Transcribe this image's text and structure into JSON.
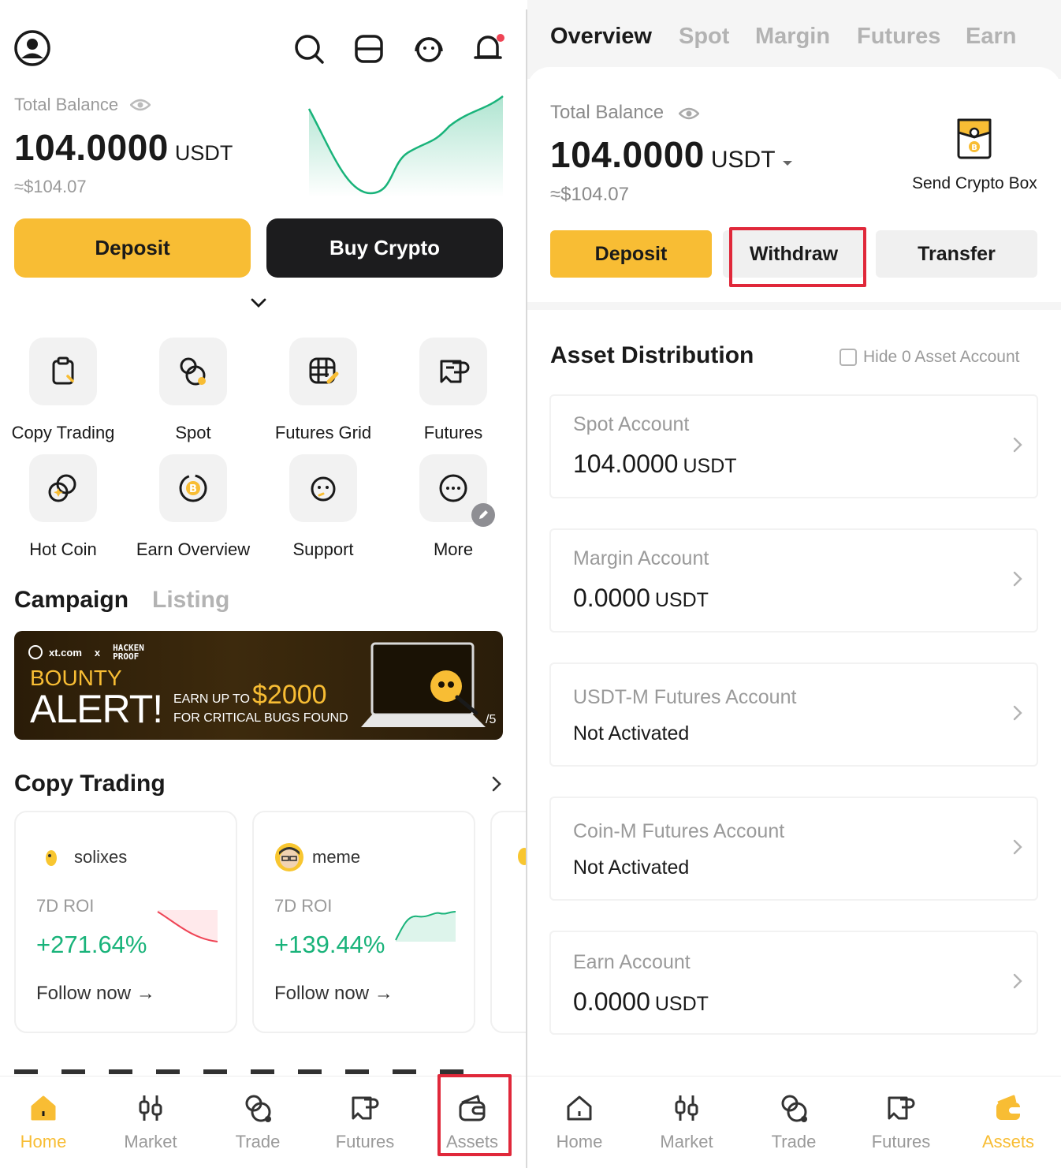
{
  "left": {
    "total_balance_label": "Total Balance",
    "balance": "104.0000",
    "unit": "USDT",
    "fiat": "≈$104.07",
    "deposit": "Deposit",
    "buy_crypto": "Buy Crypto",
    "shortcuts": [
      {
        "label": "Copy Trading",
        "icon": "clipboard-icon"
      },
      {
        "label": "Spot",
        "icon": "spot-icon"
      },
      {
        "label": "Futures Grid",
        "icon": "grid-icon"
      },
      {
        "label": "Futures",
        "icon": "futures-icon"
      },
      {
        "label": "Hot Coin",
        "icon": "hot-coin-icon"
      },
      {
        "label": "Earn Overview",
        "icon": "coin-icon"
      },
      {
        "label": "Support",
        "icon": "support-icon"
      },
      {
        "label": "More",
        "icon": "more-icon"
      }
    ],
    "campaign_tab": "Campaign",
    "listing_tab": "Listing",
    "banner": {
      "brand": "xt.com",
      "times": "x",
      "partner": "HACKEN PROOF",
      "line1": "BOUNTY",
      "line2": "ALERT!",
      "earn_up_to": "EARN UP TO",
      "amount": "$2000",
      "critical": "FOR CRITICAL BUGS FOUND",
      "page": "/5"
    },
    "copy_trading_title": "Copy Trading",
    "traders": [
      {
        "name": "solixes",
        "roi_label": "7D ROI",
        "roi": "+271.64%",
        "follow": "Follow now →"
      },
      {
        "name": "meme",
        "roi_label": "7D ROI",
        "roi": "+139.44%",
        "follow": "Follow now →"
      }
    ],
    "tabs": [
      {
        "label": "Home",
        "icon": "home-icon",
        "active": true
      },
      {
        "label": "Market",
        "icon": "candlestick-icon",
        "active": false
      },
      {
        "label": "Trade",
        "icon": "trade-icon",
        "active": false
      },
      {
        "label": "Futures",
        "icon": "futures-icon",
        "active": false
      },
      {
        "label": "Assets",
        "icon": "wallet-icon",
        "active": false
      }
    ]
  },
  "right": {
    "top_tabs": [
      "Overview",
      "Spot",
      "Margin",
      "Futures",
      "Earn"
    ],
    "total_balance_label": "Total Balance",
    "balance": "104.0000",
    "unit": "USDT",
    "fiat": "≈$104.07",
    "send_crypto_box": "Send Crypto Box",
    "deposit": "Deposit",
    "withdraw": "Withdraw",
    "transfer": "Transfer",
    "asset_distribution": "Asset Distribution",
    "hide_zero": "Hide 0 Asset Account",
    "accounts": [
      {
        "name": "Spot Account",
        "value": "104.0000",
        "unit": "USDT"
      },
      {
        "name": "Margin Account",
        "value": "0.0000",
        "unit": "USDT"
      },
      {
        "name": "USDT-M Futures Account",
        "value": "Not Activated",
        "unit": ""
      },
      {
        "name": "Coin-M Futures Account",
        "value": "Not Activated",
        "unit": ""
      },
      {
        "name": "Earn Account",
        "value": "0.0000",
        "unit": "USDT"
      }
    ],
    "tabs": [
      {
        "label": "Home",
        "icon": "home-icon",
        "active": false
      },
      {
        "label": "Market",
        "icon": "candlestick-icon",
        "active": false
      },
      {
        "label": "Trade",
        "icon": "trade-icon",
        "active": false
      },
      {
        "label": "Futures",
        "icon": "futures-icon",
        "active": false
      },
      {
        "label": "Assets",
        "icon": "wallet-icon",
        "active": true
      }
    ]
  },
  "colors": {
    "accent": "#f8bd34",
    "positive": "#19b37a",
    "highlight": "#e0283a"
  }
}
